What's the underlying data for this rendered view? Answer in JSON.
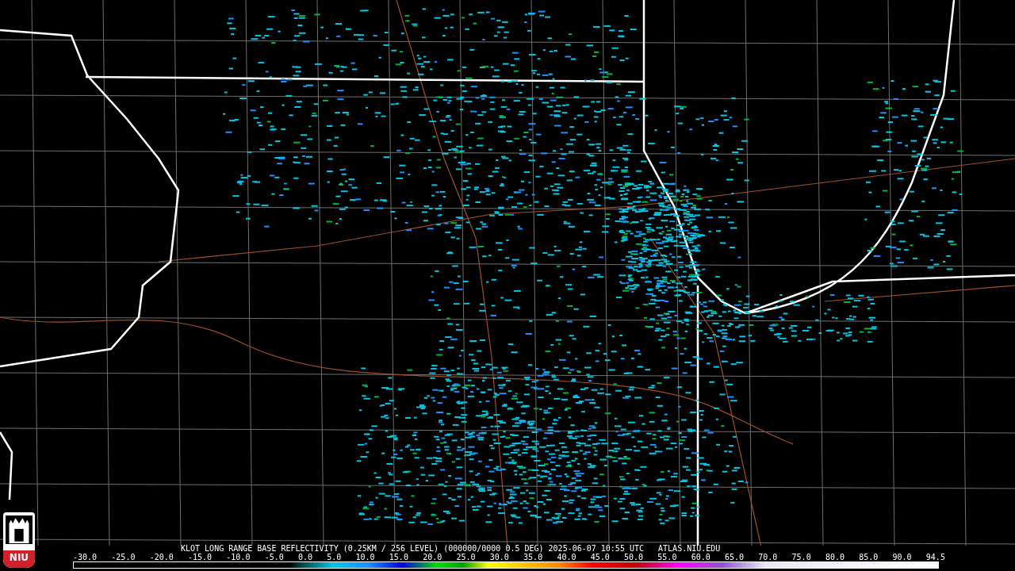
{
  "logo": {
    "text": "NIU"
  },
  "caption": "KLOT LONG RANGE BASE REFLECTIVITY (0.25KM / 256 LEVEL) (000000/0000 0.5 DEG) 2025-06-07 10:55 UTC   ATLAS.NIU.EDU",
  "legend": {
    "labels": [
      "-30.0",
      "-25.0",
      "-20.0",
      "-15.0",
      "-10.0",
      "-5.0",
      "0.0",
      "5.0",
      "10.0",
      "15.0",
      "20.0",
      "25.0",
      "30.0",
      "35.0",
      "40.0",
      "45.0",
      "50.0",
      "55.0",
      "60.0",
      "65.0",
      "70.0",
      "75.0",
      "80.0",
      "85.0",
      "90.0",
      "94.5"
    ]
  }
}
